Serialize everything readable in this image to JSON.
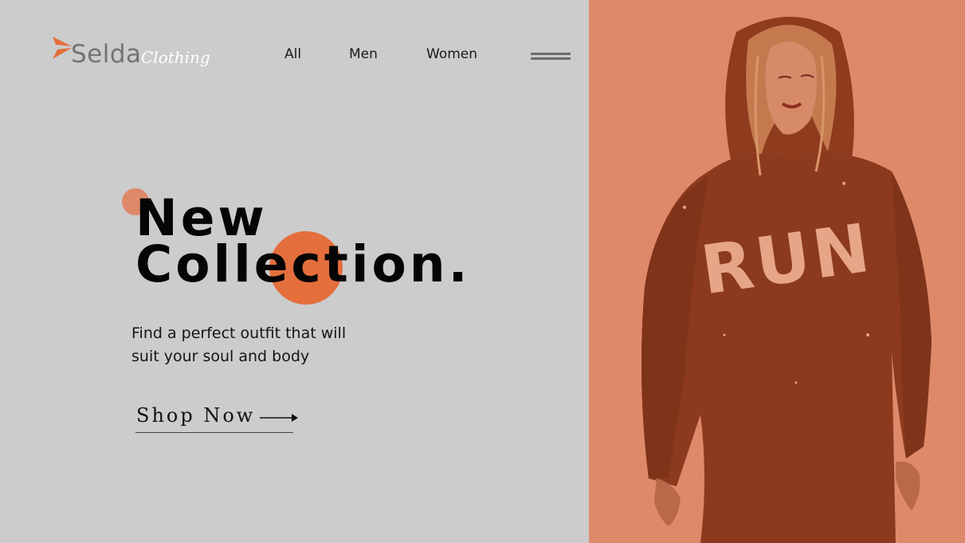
{
  "brand": {
    "name": "Selda",
    "subtitle": "Clothing",
    "accent_color": "#e46e3c",
    "panel_color": "#df896b"
  },
  "nav": {
    "items": [
      {
        "label": "All"
      },
      {
        "label": "Men"
      },
      {
        "label": "Women"
      }
    ],
    "menu_icon": "hamburger-menu-icon"
  },
  "hero": {
    "title_line1": "New",
    "title_line2": "Collection.",
    "tagline_line1": "Find a perfect outfit that will",
    "tagline_line2": "suit your soul and body",
    "cta_label": "Shop Now",
    "cta_icon": "arrow-right-icon"
  },
  "photo": {
    "hoodie_print": "RUN"
  }
}
